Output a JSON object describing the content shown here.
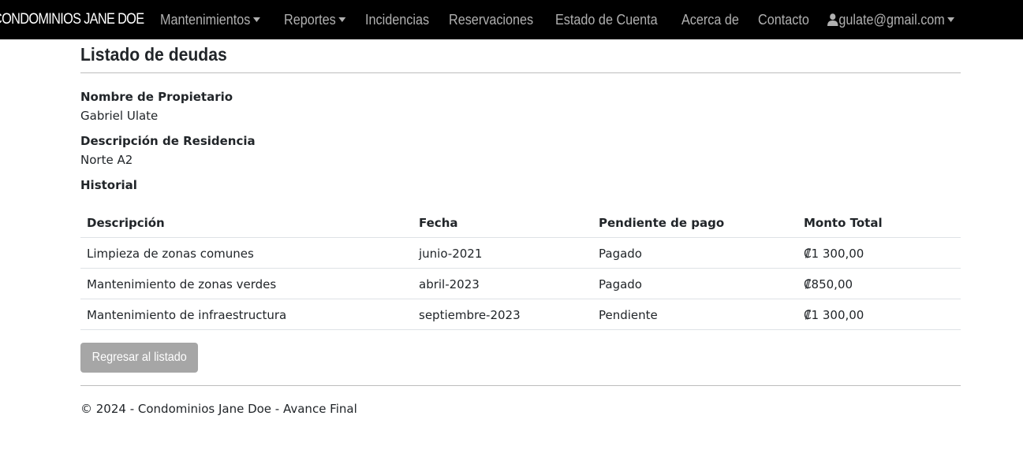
{
  "navbar": {
    "brand": "CONDOMINIOS JANE DOE",
    "items": [
      {
        "label": "Mantenimientos",
        "dropdown": true
      },
      {
        "label": "Reportes",
        "dropdown": true
      },
      {
        "label": "Incidencias",
        "dropdown": false
      },
      {
        "label": "Reservaciones",
        "dropdown": false
      },
      {
        "label": "Estado de Cuenta",
        "dropdown": false
      },
      {
        "label": "Acerca de",
        "dropdown": false
      },
      {
        "label": "Contacto",
        "dropdown": false
      }
    ],
    "user": {
      "email": "gulate@gmail.com",
      "icon": "user-icon"
    }
  },
  "main": {
    "title": "Listado de deudas",
    "owner_label": "Nombre de Propietario",
    "owner_value": "Gabriel Ulate",
    "residence_label": "Descripción de Residencia",
    "residence_value": "Norte A2",
    "history_label": "Historial",
    "table": {
      "headers": [
        "Descripción",
        "Fecha",
        "Pendiente de pago",
        "Monto Total"
      ],
      "rows": [
        [
          "Limpieza de zonas comunes",
          "junio-2021",
          "Pagado",
          "₡1 300,00"
        ],
        [
          "Mantenimiento de zonas verdes",
          "abril-2023",
          "Pagado",
          "₡850,00"
        ],
        [
          "Mantenimiento de infraestructura",
          "septiembre-2023",
          "Pendiente",
          "₡1 300,00"
        ]
      ]
    },
    "back_button": "Regresar al listado"
  },
  "footer": {
    "text": "© 2024 - Condominios Jane Doe - Avance Final"
  },
  "colors": {
    "navbar_bg": "#000000",
    "nav_text": "#b0b0b0",
    "button_bg": "#a6a6a6"
  }
}
